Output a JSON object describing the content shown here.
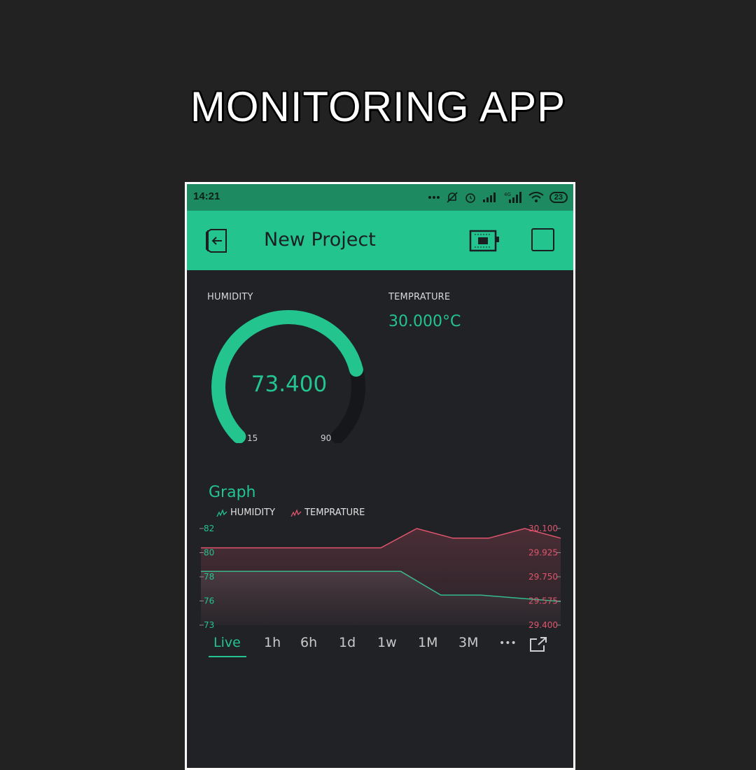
{
  "poster": {
    "title": "MONITORING APP"
  },
  "status_bar": {
    "time": "14:21",
    "battery": "23"
  },
  "app_bar": {
    "title": "New Project"
  },
  "widgets": {
    "humidity_label": "HUMIDITY",
    "humidity_value": "73.400",
    "gauge_min": "15",
    "gauge_max": "90",
    "gauge_fraction": 0.78,
    "temperature_label": "TEMPRATURE",
    "temperature_value": "30.000°C"
  },
  "graph": {
    "title": "Graph",
    "legend": [
      "HUMIDITY",
      "TEMPRATURE"
    ],
    "ranges": [
      "Live",
      "1h",
      "6h",
      "1d",
      "1w",
      "1M",
      "3M"
    ],
    "active_range": "Live",
    "more_label": "•••"
  },
  "colors": {
    "accent": "#23c48e",
    "temperature": "#e0556d",
    "background": "#212226"
  },
  "chart_data": {
    "type": "line",
    "series": [
      {
        "name": "HUMIDITY",
        "axis": "left",
        "values": [
          78.0,
          78.0,
          78.0,
          78.0,
          78.0,
          78.0,
          75.8,
          75.8,
          75.5,
          75.2
        ]
      },
      {
        "name": "TEMPRATURE",
        "axis": "right",
        "values": [
          29.96,
          29.96,
          29.96,
          29.96,
          29.96,
          29.96,
          30.1,
          30.03,
          30.03,
          30.1,
          30.03
        ]
      }
    ],
    "y_left_ticks": [
      "82",
      "80",
      "78",
      "76",
      "73"
    ],
    "y_right_ticks": [
      "30.100",
      "29.925",
      "29.750",
      "29.575",
      "29.400"
    ],
    "y_left_range": [
      73,
      82
    ],
    "y_right_range": [
      29.4,
      30.1
    ]
  }
}
